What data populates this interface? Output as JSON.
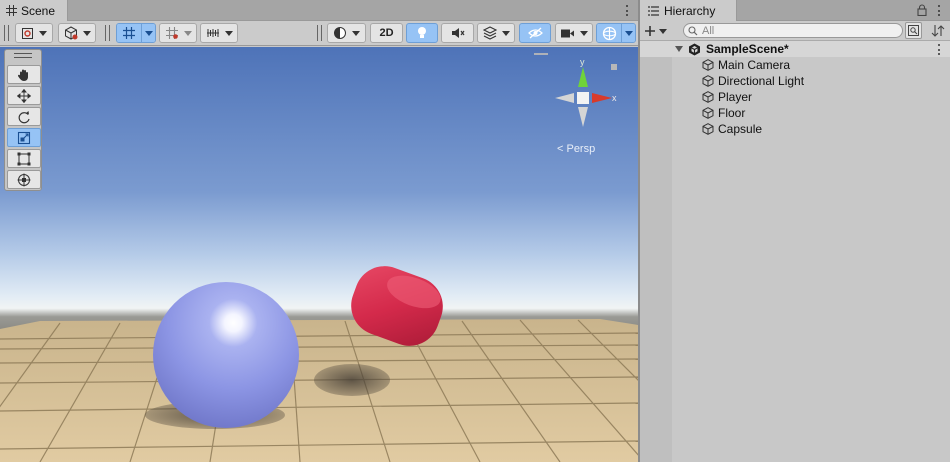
{
  "scene_panel": {
    "tab_label": "Scene",
    "toolbar": {
      "mode_2d_label": "2D"
    },
    "gizmo": {
      "projection_label": "< Persp",
      "axis_x_label": "x",
      "axis_y_label": "y"
    },
    "tools": [
      "hand-tool",
      "move-tool",
      "rotate-tool",
      "scale-tool",
      "rect-tool",
      "transform-tool"
    ],
    "active_tool": "scale-tool"
  },
  "hierarchy": {
    "tab_label": "Hierarchy",
    "search_placeholder": "All",
    "scene_name": "SampleScene*",
    "items": [
      {
        "label": "Main Camera"
      },
      {
        "label": "Directional Light"
      },
      {
        "label": "Player"
      },
      {
        "label": "Floor"
      },
      {
        "label": "Capsule"
      }
    ]
  },
  "colors": {
    "selection_blue": "#96c3f5",
    "sphere": "#8f98e8",
    "capsule": "#d42a4b",
    "sky_top": "#4e73b8",
    "floor": "#d9c29a"
  }
}
